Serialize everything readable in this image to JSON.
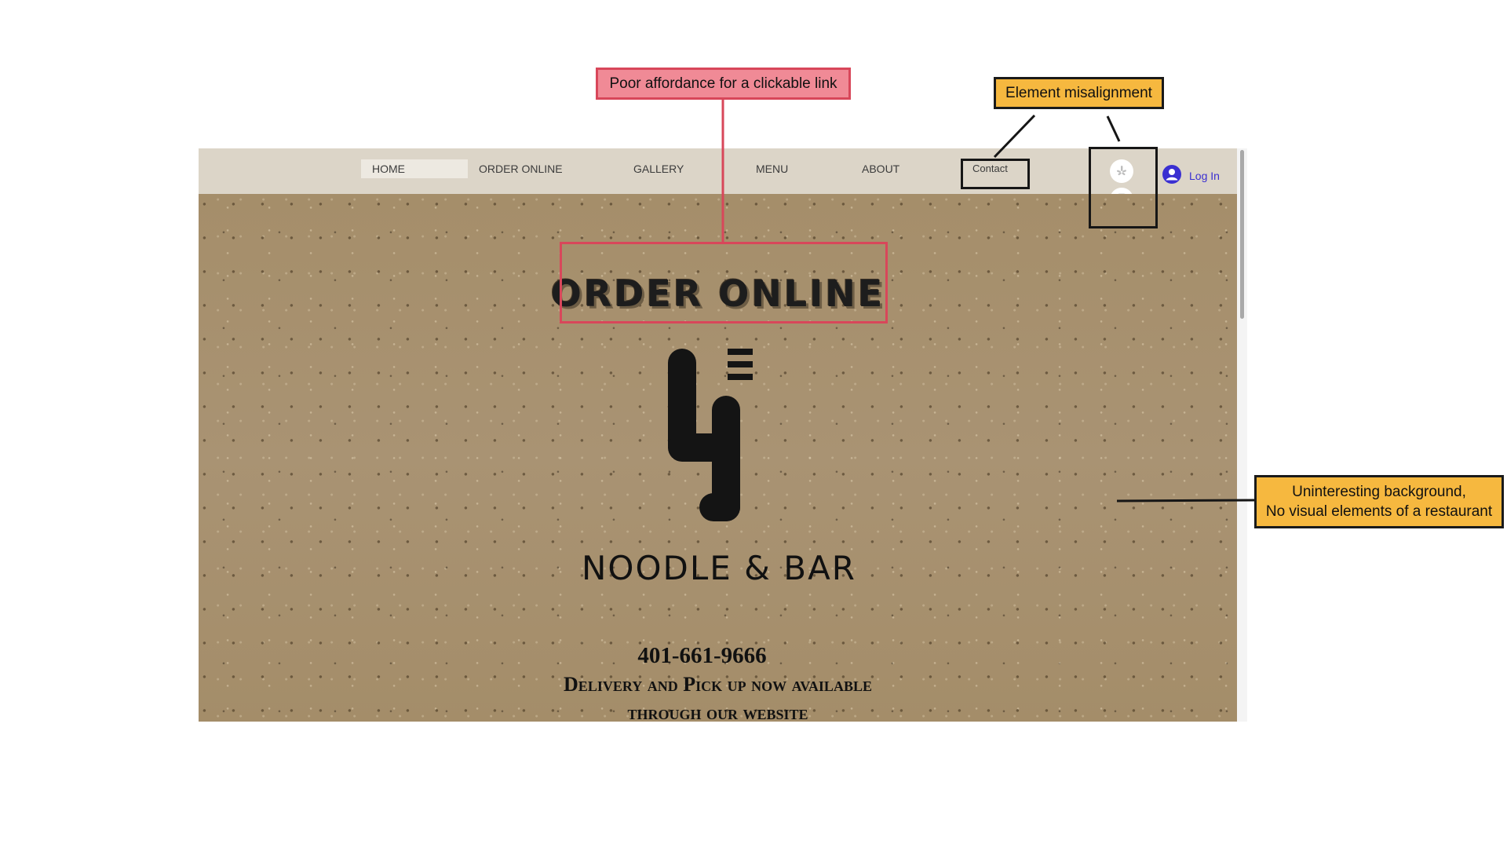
{
  "nav": {
    "items": [
      "HOME",
      "ORDER ONLINE",
      "GALLERY",
      "MENU",
      "ABOUT",
      "Contact"
    ],
    "login": "Log In"
  },
  "social": {
    "icons": [
      "yelp-icon",
      "instagram-icon"
    ]
  },
  "hero": {
    "heading": "ORDER ONLINE",
    "brand": "NOODLE & BAR",
    "phone": "401-661-9666",
    "delivery_line1": "Delivery and Pick up now available",
    "delivery_line2": "through our website"
  },
  "annotations": {
    "poor_affordance": "Poor affordance for a clickable link",
    "misalignment": "Element misalignment",
    "background_line1": "Uninteresting background,",
    "background_line2": "No visual elements of a restaurant"
  },
  "colors": {
    "pink_callout": "#f08a96",
    "pink_border": "#d8475a",
    "yellow_callout": "#f6b83f",
    "login_blue": "#3a2fd1",
    "paper_background": "#a89070"
  }
}
